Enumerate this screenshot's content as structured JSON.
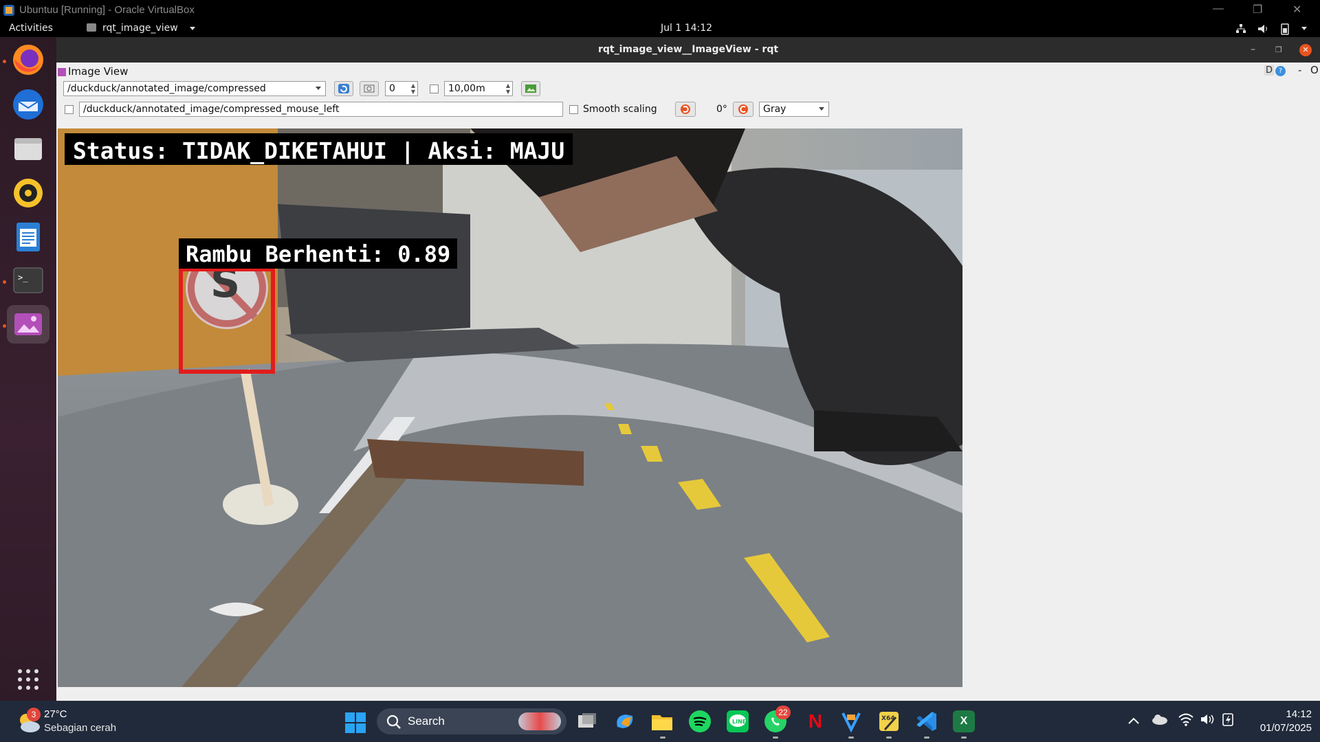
{
  "vbox": {
    "title": "Ubuntuu [Running] - Oracle VirtualBox"
  },
  "gnome": {
    "activities": "Activities",
    "app_menu": "rqt_image_view",
    "clock": "Jul 1  14:12"
  },
  "rqt": {
    "window_title": "rqt_image_view__ImageView - rqt",
    "plugin_title": "Image View",
    "plugin_controls": "D",
    "topic": "/duckduck/annotated_image/compressed",
    "spin_value": "0",
    "distance_value": "10,00m",
    "mouse_topic": "/duckduck/annotated_image/compressed_mouse_left",
    "smooth_scaling_label": "Smooth scaling",
    "rotation": "0°",
    "color_scheme": "Gray"
  },
  "camera": {
    "status_label": "Status: TIDAK_DIKETAHUI | Aksi: MAJU",
    "detection_label": "Rambu Berhenti: 0.89",
    "sign_letter": "S"
  },
  "taskbar": {
    "weather_temp": "27°C",
    "weather_desc": "Sebagian cerah",
    "weather_badge": "3",
    "search_label": "Search",
    "whatsapp_badge": "22",
    "time": "14:12",
    "date": "01/07/2025"
  },
  "colors": {
    "ubuntu_orange": "#e95420",
    "detect_red": "#e21c1c",
    "lane_yellow": "#e6c93a"
  }
}
